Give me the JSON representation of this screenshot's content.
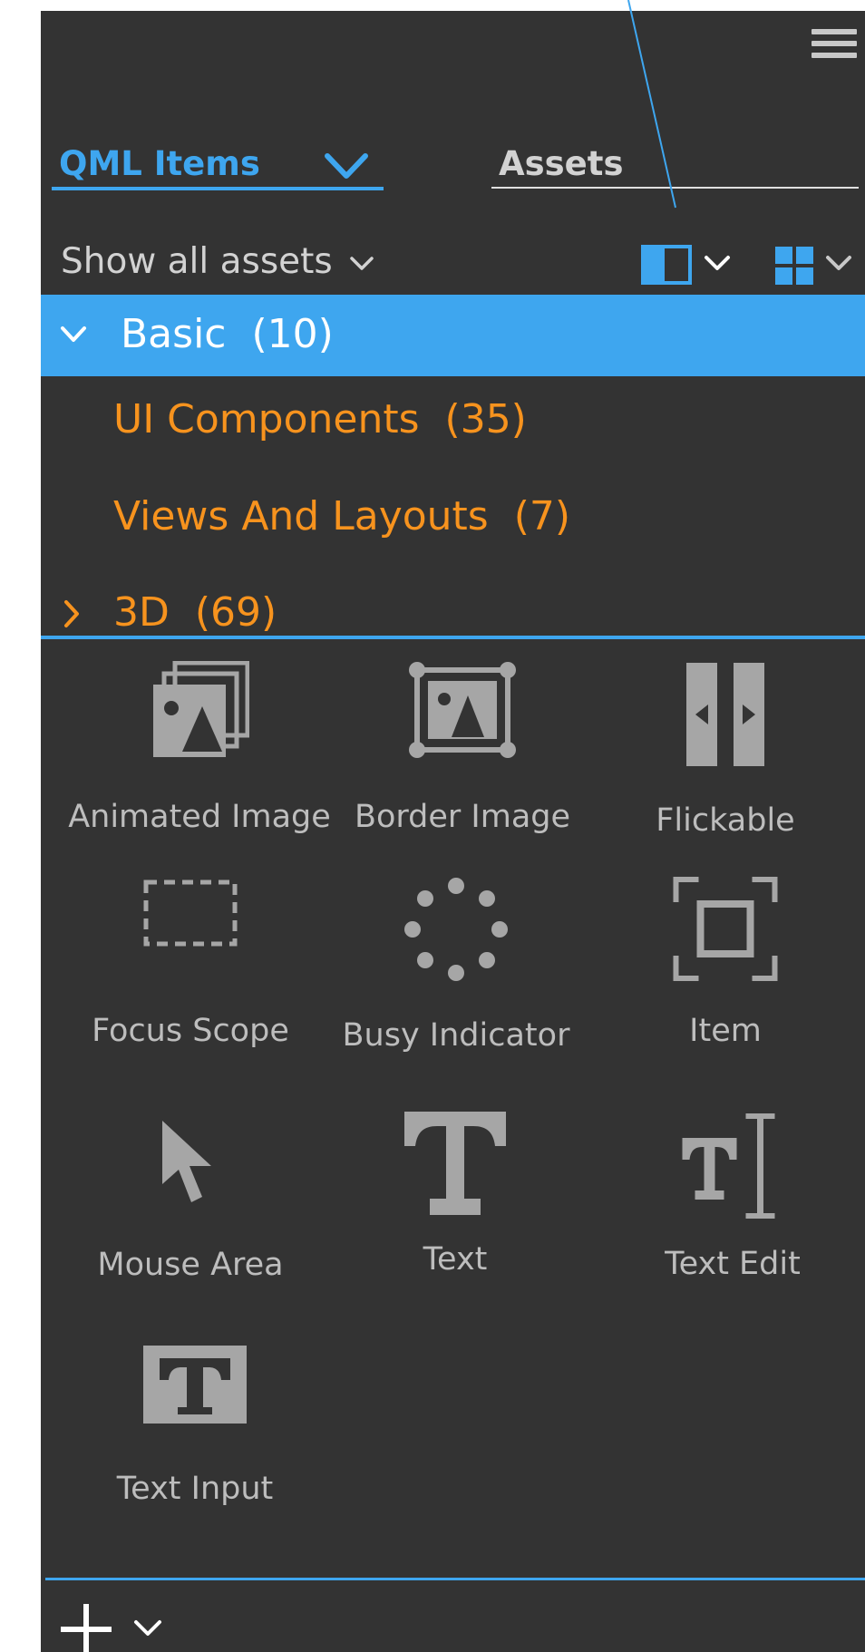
{
  "toolbar": {
    "menu_icon": "hamburger-icon"
  },
  "tabs": [
    {
      "label": "QML Items",
      "active": true
    },
    {
      "label": "Assets",
      "active": false
    }
  ],
  "filter": {
    "label": "Show all assets"
  },
  "categories": [
    {
      "name": "Basic",
      "count": "(10)",
      "expanded": true,
      "selected": true
    },
    {
      "name": "UI Components",
      "count": "(35)"
    },
    {
      "name": "Views And Layouts",
      "count": "(7)"
    },
    {
      "name": "3D",
      "count": "(69)",
      "expanded": false
    }
  ],
  "items": [
    {
      "label": "Animated Image",
      "icon": "animated-image-icon"
    },
    {
      "label": "Border Image",
      "icon": "border-image-icon"
    },
    {
      "label": "Flickable",
      "icon": "flickable-icon"
    },
    {
      "label": "Focus Scope",
      "icon": "focus-scope-icon"
    },
    {
      "label": "Busy Indicator",
      "icon": "busy-indicator-icon"
    },
    {
      "label": "Item",
      "icon": "item-icon"
    },
    {
      "label": "Mouse Area",
      "icon": "mouse-area-icon"
    },
    {
      "label": "Text",
      "icon": "text-icon"
    },
    {
      "label": "Text Edit",
      "icon": "text-edit-icon"
    },
    {
      "label": "Text Input",
      "icon": "text-input-icon"
    }
  ],
  "colors": {
    "panel_bg": "#333333",
    "accent": "#3ea6ef",
    "category_text": "#f7931e",
    "icon_gray": "#a6a6a6",
    "label_gray": "#bdbdbd"
  }
}
